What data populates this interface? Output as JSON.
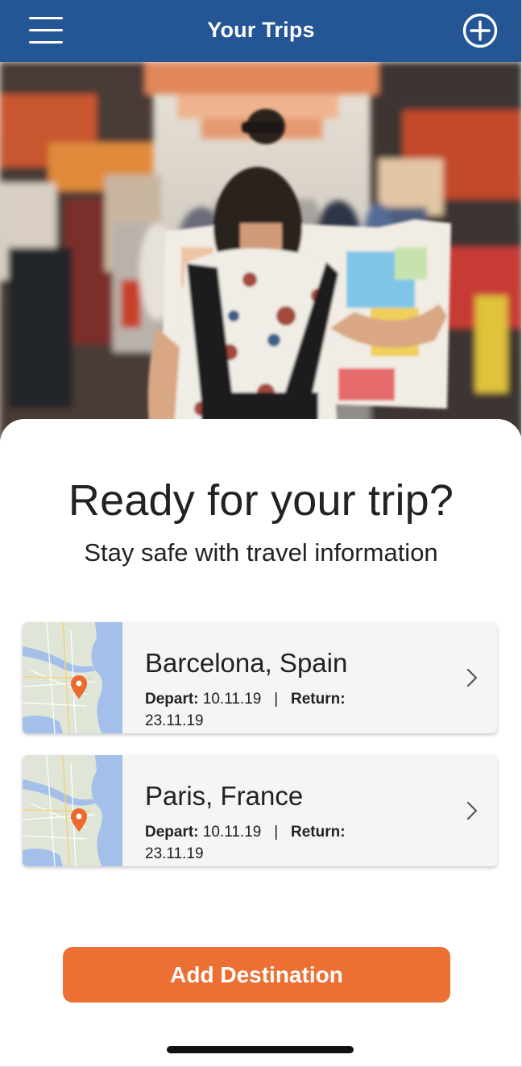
{
  "header": {
    "title": "Your Trips",
    "menu_icon": "hamburger-menu-icon",
    "add_icon": "plus-circle-icon",
    "background_color": "#245594"
  },
  "hero": {
    "image": "traveler-with-map-in-market-street"
  },
  "intro": {
    "headline": "Ready for your trip?",
    "subheadline": "Stay safe with travel information"
  },
  "trips": [
    {
      "destination": "Barcelona, Spain",
      "depart_label": "Depart:",
      "depart_date": "10.11.19",
      "separator": "|",
      "return_label": "Return:",
      "return_date": "23.11.19"
    },
    {
      "destination": "Paris, France",
      "depart_label": "Depart:",
      "depart_date": "10.11.19",
      "separator": "|",
      "return_label": "Return:",
      "return_date": "23.11.19"
    }
  ],
  "actions": {
    "add_destination_label": "Add Destination",
    "accent_color": "#ec7033"
  }
}
